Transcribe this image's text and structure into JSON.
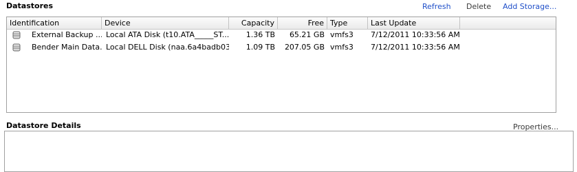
{
  "datastores": {
    "title": "Datastores",
    "actions": {
      "refresh": "Refresh",
      "delete": "Delete",
      "add_storage": "Add Storage..."
    },
    "columns": [
      "Identification",
      "Device",
      "Capacity",
      "Free",
      "Type",
      "Last Update"
    ],
    "rows": [
      {
        "identification": "External Backup ...",
        "device": "Local ATA Disk (t10.ATA_____ST...",
        "capacity": "1.36 TB",
        "free": "65.21 GB",
        "type": "vmfs3",
        "last_update": "7/12/2011 10:33:56 AM",
        "icon": "database-icon"
      },
      {
        "identification": "Bender Main Data...",
        "device": "Local DELL Disk (naa.6a4badb03...",
        "capacity": "1.09 TB",
        "free": "207.05 GB",
        "type": "vmfs3",
        "last_update": "7/12/2011 10:33:56 AM",
        "icon": "database-icon"
      }
    ]
  },
  "details": {
    "title": "Datastore Details",
    "properties": "Properties..."
  },
  "colors": {
    "link": "#1f4fc9",
    "border": "#a0a0a0",
    "header_bg": "#f0f0f0"
  }
}
